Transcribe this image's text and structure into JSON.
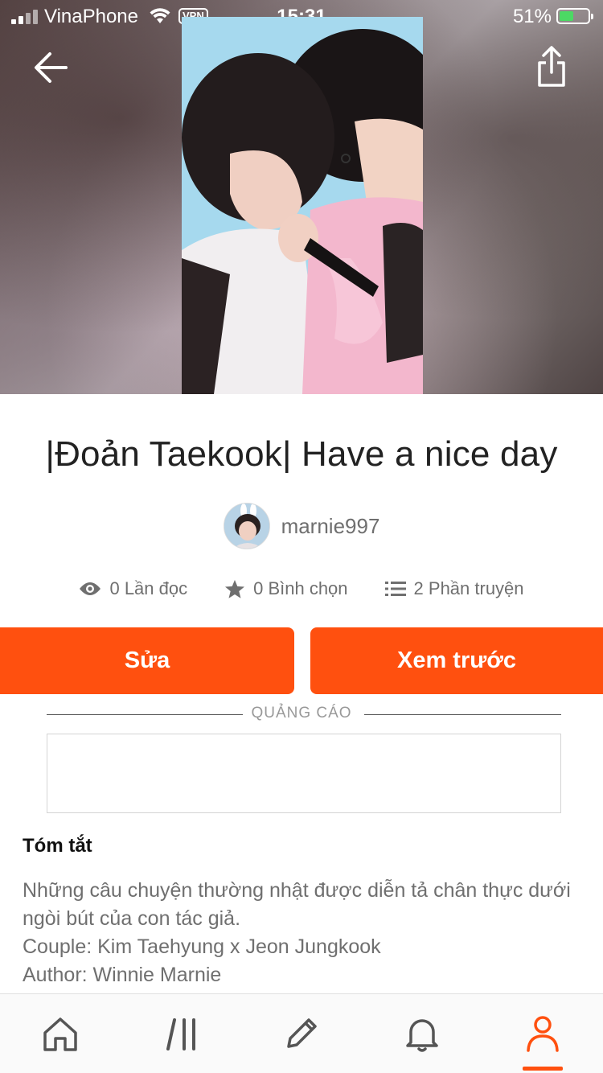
{
  "status_bar": {
    "carrier": "VinaPhone",
    "vpn": "VPN",
    "time": "15:31",
    "battery_percent": "51%"
  },
  "story": {
    "title": "|Đoản Taekook| Have a nice day",
    "author": "marnie997",
    "stats": {
      "reads": "0 Lần đọc",
      "votes": "0 Bình chọn",
      "parts": "2 Phần truyện"
    }
  },
  "actions": {
    "edit_label": "Sửa",
    "preview_label": "Xem trước"
  },
  "ad": {
    "label": "QUẢNG CÁO"
  },
  "summary": {
    "heading": "Tóm tắt",
    "lines": [
      "Những câu chuyện thường nhật được diễn tả chân thực dưới ngòi bút của con tác giả.",
      "Couple: Kim Taehyung x Jeon Jungkook",
      "Author: Winnie Marnie"
    ]
  },
  "icons": {
    "back": "arrow-left-icon",
    "share": "share-icon",
    "reads": "eye-icon",
    "votes": "star-icon",
    "parts": "list-icon",
    "tabs": [
      "home-icon",
      "library-icon",
      "pencil-icon",
      "bell-icon",
      "profile-icon"
    ]
  },
  "colors": {
    "accent": "#ff500f",
    "muted_text": "#6f6f6f"
  }
}
